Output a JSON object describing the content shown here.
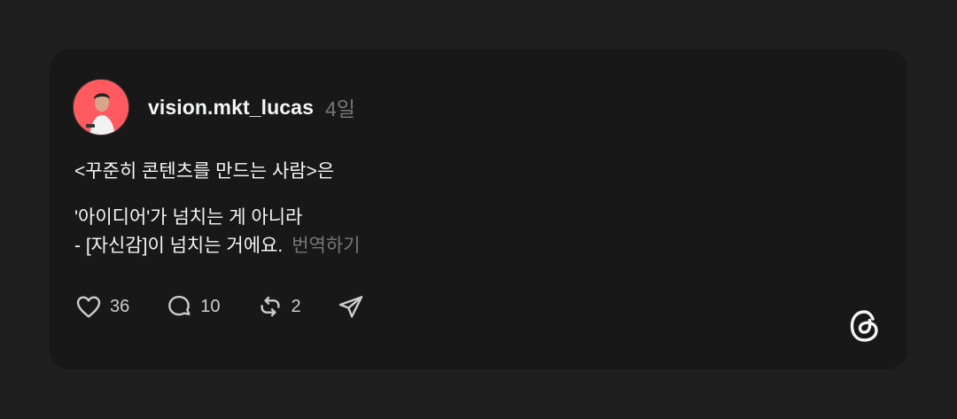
{
  "post": {
    "username": "vision.mkt_lucas",
    "time": "4일",
    "line1": "<꾸준히 콘텐츠를 만드는 사람>은",
    "line2": "'아이디어'가 넘치는 게 아니라",
    "line3": "- [자신감]이 넘치는 거에요.",
    "translate_label": "번역하기"
  },
  "actions": {
    "likes": "36",
    "comments": "10",
    "reposts": "2"
  },
  "icons": {
    "like": "heart-icon",
    "comment": "comment-bubble-icon",
    "repost": "repost-icon",
    "share": "send-icon",
    "brand": "threads-logo-icon"
  },
  "colors": {
    "background": "#1f1f1f",
    "card": "#181818",
    "text": "#f3f5f7",
    "muted": "#777777",
    "avatar_bg": "#ff5a5f"
  }
}
